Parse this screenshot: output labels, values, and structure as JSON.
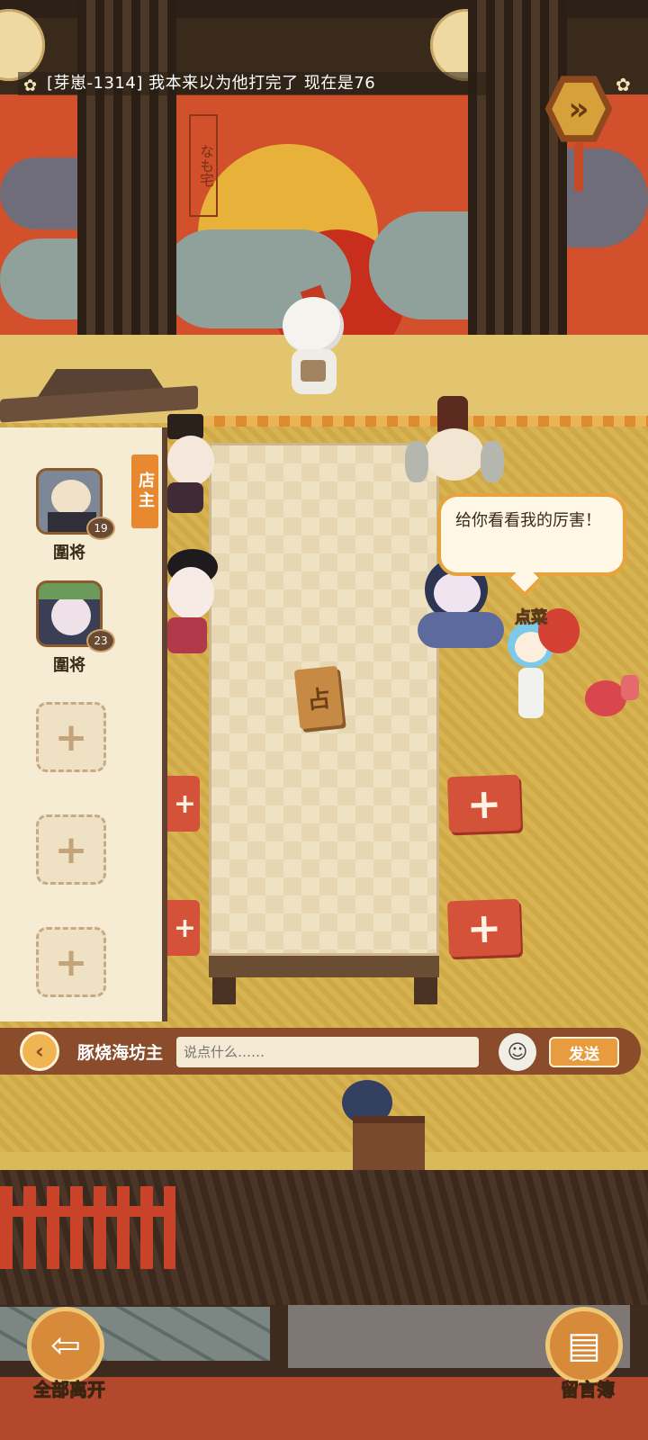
{
  "ticker": {
    "message": "[芽崽-1314] 我本来以为他打完了 现在是76"
  },
  "mural": {
    "vertical_text": "なも宅"
  },
  "table": {
    "sign_glyph": "占"
  },
  "speech_bubble": {
    "text": "给你看看我的厉害！"
  },
  "order_label": "点菜",
  "staff_panel": {
    "title": "店主",
    "staff": [
      {
        "role": "圍将",
        "level": "19"
      },
      {
        "role": "圍将",
        "level": "23"
      }
    ],
    "empty_slots": 3
  },
  "seat_buttons": [
    "+",
    "+"
  ],
  "chat_bar": {
    "shop_name": "豚烧海坊主",
    "input_placeholder": "说点什么……",
    "send_label": "发送"
  },
  "bottom": {
    "leave_all_label": "全部离开",
    "guestbook_label": "留言簿"
  },
  "colors": {
    "accent_orange": "#e8892f",
    "chat_bar": "#8a4c2b",
    "seat_red": "#d4513a"
  }
}
